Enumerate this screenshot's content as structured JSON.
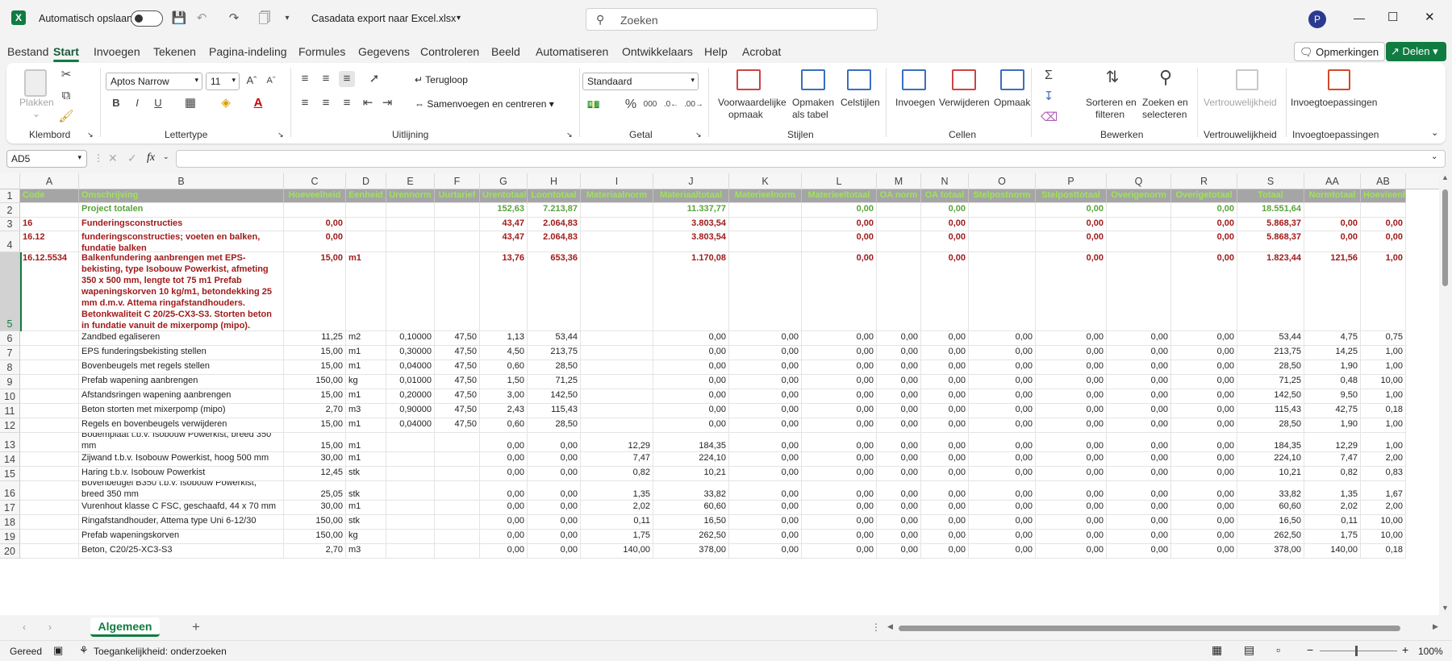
{
  "app": {
    "file_title": "Casadata export naar Excel.xlsx",
    "autosave_label": "Automatisch opslaan",
    "search_placeholder": "Zoeken",
    "user_initial": "P"
  },
  "menu": [
    "Bestand",
    "Start",
    "Invoegen",
    "Tekenen",
    "Pagina-indeling",
    "Formules",
    "Gegevens",
    "Controleren",
    "Beeld",
    "Automatiseren",
    "Ontwikkelaars",
    "Help",
    "Acrobat"
  ],
  "menu_active": "Start",
  "comments_label": "Opmerkingen",
  "share_label": "Delen",
  "ribbon": {
    "klembord": {
      "label": "Klembord",
      "paste": "Plakken"
    },
    "lettertype": {
      "label": "Lettertype",
      "font": "Aptos Narrow",
      "size": "11"
    },
    "uitlijning": {
      "label": "Uitlijning",
      "wrap": "Terugloop",
      "merge": "Samenvoegen en centreren"
    },
    "getal": {
      "label": "Getal",
      "format": "Standaard"
    },
    "stijlen": {
      "label": "Stijlen",
      "cond": "Voorwaardelijke",
      "cond2": "opmaak",
      "table": "Opmaken",
      "table2": "als tabel",
      "cell": "Celstijlen"
    },
    "cellen": {
      "label": "Cellen",
      "insert": "Invoegen",
      "delete": "Verwijderen",
      "format": "Opmaak"
    },
    "bewerken": {
      "label": "Bewerken",
      "sort": "Sorteren en",
      "sort2": "filteren",
      "find": "Zoeken en",
      "find2": "selecteren"
    },
    "vertrouw": {
      "label": "Vertrouwelijkheid",
      "btn": "Vertrouwelijkheid"
    },
    "invoeg": {
      "label": "Invoegtoepassingen",
      "btn": "Invoegtoepassingen"
    }
  },
  "namebox": "AD5",
  "columns": [
    "A",
    "B",
    "C",
    "D",
    "E",
    "F",
    "G",
    "H",
    "I",
    "J",
    "K",
    "L",
    "M",
    "N",
    "O",
    "P",
    "Q",
    "R",
    "S",
    "AA",
    "AB"
  ],
  "header_row": [
    "Code",
    "Omschrijving",
    "Hoeveelheid",
    "Eenheid",
    "Urennorm",
    "Uurtarief",
    "Urentotaal",
    "Loontotaal",
    "Materiaalnorm",
    "Materiaaltotaal",
    "Materieelnorm",
    "Materieeltotaal",
    "OA norm",
    "OA totaal",
    "Stelpostnorm",
    "Stelposttotaal",
    "Overigenorm",
    "Overigetotaal",
    "Totaal",
    "Normtotaal",
    "Hoev/eenh"
  ],
  "rows": [
    {
      "n": "2",
      "c": [
        "",
        "Project totalen",
        "",
        "",
        "",
        "",
        "152,63",
        "7.213,87",
        "",
        "11.337,77",
        "",
        "0,00",
        "",
        "0,00",
        "",
        "0,00",
        "",
        "0,00",
        "18.551,64",
        "",
        ""
      ]
    },
    {
      "n": "3",
      "c": [
        "16",
        "Funderingsconstructies",
        "0,00",
        "",
        "",
        "",
        "43,47",
        "2.064,83",
        "",
        "3.803,54",
        "",
        "0,00",
        "",
        "0,00",
        "",
        "0,00",
        "",
        "0,00",
        "5.868,37",
        "0,00",
        "0,00"
      ]
    },
    {
      "n": "4",
      "c": [
        "16.12",
        "funderingsconstructies; voeten en balken, fundatie balken",
        "0,00",
        "",
        "",
        "",
        "43,47",
        "2.064,83",
        "",
        "3.803,54",
        "",
        "0,00",
        "",
        "0,00",
        "",
        "0,00",
        "",
        "0,00",
        "5.868,37",
        "0,00",
        "0,00"
      ]
    },
    {
      "n": "5",
      "c": [
        "16.12.5534",
        "Balkenfundering aanbrengen met EPS-bekisting, type Isobouw Powerkist, afmeting 350 x 500 mm, lengte tot 75 m1 Prefab wapeningskorven 10 kg/m1, betondekking 25 mm d.m.v. Attema ringafstandhouders. Betonkwaliteit C 20/25-CX3-S3. Storten beton in fundatie vanuit de mixerpomp (mipo).",
        "15,00",
        "m1",
        "",
        "",
        "13,76",
        "653,36",
        "",
        "1.170,08",
        "",
        "0,00",
        "",
        "0,00",
        "",
        "0,00",
        "",
        "0,00",
        "1.823,44",
        "121,56",
        "1,00"
      ]
    },
    {
      "n": "6",
      "c": [
        "",
        "Zandbed egaliseren",
        "11,25",
        "m2",
        "0,10000",
        "47,50",
        "1,13",
        "53,44",
        "",
        "0,00",
        "0,00",
        "0,00",
        "0,00",
        "0,00",
        "0,00",
        "0,00",
        "0,00",
        "0,00",
        "53,44",
        "4,75",
        "0,75"
      ]
    },
    {
      "n": "7",
      "c": [
        "",
        "EPS funderingsbekisting stellen",
        "15,00",
        "m1",
        "0,30000",
        "47,50",
        "4,50",
        "213,75",
        "",
        "0,00",
        "0,00",
        "0,00",
        "0,00",
        "0,00",
        "0,00",
        "0,00",
        "0,00",
        "0,00",
        "213,75",
        "14,25",
        "1,00"
      ]
    },
    {
      "n": "8",
      "c": [
        "",
        "Bovenbeugels met regels stellen",
        "15,00",
        "m1",
        "0,04000",
        "47,50",
        "0,60",
        "28,50",
        "",
        "0,00",
        "0,00",
        "0,00",
        "0,00",
        "0,00",
        "0,00",
        "0,00",
        "0,00",
        "0,00",
        "28,50",
        "1,90",
        "1,00"
      ]
    },
    {
      "n": "9",
      "c": [
        "",
        "Prefab wapening aanbrengen",
        "150,00",
        "kg",
        "0,01000",
        "47,50",
        "1,50",
        "71,25",
        "",
        "0,00",
        "0,00",
        "0,00",
        "0,00",
        "0,00",
        "0,00",
        "0,00",
        "0,00",
        "0,00",
        "71,25",
        "0,48",
        "10,00"
      ]
    },
    {
      "n": "10",
      "c": [
        "",
        "Afstandsringen wapening aanbrengen",
        "15,00",
        "m1",
        "0,20000",
        "47,50",
        "3,00",
        "142,50",
        "",
        "0,00",
        "0,00",
        "0,00",
        "0,00",
        "0,00",
        "0,00",
        "0,00",
        "0,00",
        "0,00",
        "142,50",
        "9,50",
        "1,00"
      ]
    },
    {
      "n": "11",
      "c": [
        "",
        "Beton storten met mixerpomp (mipo)",
        "2,70",
        "m3",
        "0,90000",
        "47,50",
        "2,43",
        "115,43",
        "",
        "0,00",
        "0,00",
        "0,00",
        "0,00",
        "0,00",
        "0,00",
        "0,00",
        "0,00",
        "0,00",
        "115,43",
        "42,75",
        "0,18"
      ]
    },
    {
      "n": "12",
      "c": [
        "",
        "Regels en bovenbeugels verwijderen",
        "15,00",
        "m1",
        "0,04000",
        "47,50",
        "0,60",
        "28,50",
        "",
        "0,00",
        "0,00",
        "0,00",
        "0,00",
        "0,00",
        "0,00",
        "0,00",
        "0,00",
        "0,00",
        "28,50",
        "1,90",
        "1,00"
      ]
    },
    {
      "n": "13",
      "c": [
        "",
        "Bodemplaat t.b.v. Isobouw Powerkist, breed 350 mm",
        "15,00",
        "m1",
        "",
        "",
        "0,00",
        "0,00",
        "12,29",
        "184,35",
        "0,00",
        "0,00",
        "0,00",
        "0,00",
        "0,00",
        "0,00",
        "0,00",
        "0,00",
        "184,35",
        "12,29",
        "1,00"
      ]
    },
    {
      "n": "14",
      "c": [
        "",
        "Zijwand t.b.v. Isobouw Powerkist, hoog 500 mm",
        "30,00",
        "m1",
        "",
        "",
        "0,00",
        "0,00",
        "7,47",
        "224,10",
        "0,00",
        "0,00",
        "0,00",
        "0,00",
        "0,00",
        "0,00",
        "0,00",
        "0,00",
        "224,10",
        "7,47",
        "2,00"
      ]
    },
    {
      "n": "15",
      "c": [
        "",
        "Haring t.b.v. Isobouw Powerkist",
        "12,45",
        "stk",
        "",
        "",
        "0,00",
        "0,00",
        "0,82",
        "10,21",
        "0,00",
        "0,00",
        "0,00",
        "0,00",
        "0,00",
        "0,00",
        "0,00",
        "0,00",
        "10,21",
        "0,82",
        "0,83"
      ]
    },
    {
      "n": "16",
      "c": [
        "",
        "Bovenbeugel B350 t.b.v. Isobouw Powerkist, breed 350 mm",
        "25,05",
        "stk",
        "",
        "",
        "0,00",
        "0,00",
        "1,35",
        "33,82",
        "0,00",
        "0,00",
        "0,00",
        "0,00",
        "0,00",
        "0,00",
        "0,00",
        "0,00",
        "33,82",
        "1,35",
        "1,67"
      ]
    },
    {
      "n": "17",
      "c": [
        "",
        "Vurenhout klasse C FSC, geschaafd, 44 x 70 mm",
        "30,00",
        "m1",
        "",
        "",
        "0,00",
        "0,00",
        "2,02",
        "60,60",
        "0,00",
        "0,00",
        "0,00",
        "0,00",
        "0,00",
        "0,00",
        "0,00",
        "0,00",
        "60,60",
        "2,02",
        "2,00"
      ]
    },
    {
      "n": "18",
      "c": [
        "",
        "Ringafstandhouder, Attema type Uni 6-12/30",
        "150,00",
        "stk",
        "",
        "",
        "0,00",
        "0,00",
        "0,11",
        "16,50",
        "0,00",
        "0,00",
        "0,00",
        "0,00",
        "0,00",
        "0,00",
        "0,00",
        "0,00",
        "16,50",
        "0,11",
        "10,00"
      ]
    },
    {
      "n": "19",
      "c": [
        "",
        "Prefab wapeningskorven",
        "150,00",
        "kg",
        "",
        "",
        "0,00",
        "0,00",
        "1,75",
        "262,50",
        "0,00",
        "0,00",
        "0,00",
        "0,00",
        "0,00",
        "0,00",
        "0,00",
        "0,00",
        "262,50",
        "1,75",
        "10,00"
      ]
    },
    {
      "n": "20",
      "c": [
        "",
        "Beton, C20/25-XC3-S3",
        "2,70",
        "m3",
        "",
        "",
        "0,00",
        "0,00",
        "140,00",
        "378,00",
        "0,00",
        "0,00",
        "0,00",
        "0,00",
        "0,00",
        "0,00",
        "0,00",
        "0,00",
        "378,00",
        "140,00",
        "0,18"
      ]
    }
  ],
  "sheet_tab": "Algemeen",
  "status": {
    "ready": "Gereed",
    "accessibility": "Toegankelijkheid: onderzoeken",
    "zoom": "100%"
  },
  "colors": {
    "excel_green": "#107c41",
    "header_grey": "#a5a5a5",
    "header_text": "#9ee35a",
    "group_red": "#a01b1b",
    "total_green": "#5aa33b"
  }
}
